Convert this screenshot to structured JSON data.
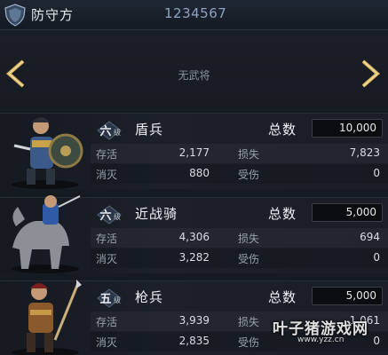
{
  "header": {
    "side_label": "防守方",
    "battle_id": "1234567"
  },
  "general": {
    "empty_text": "无武将",
    "prev_icon": "chevron-left-icon",
    "next_icon": "chevron-right-icon"
  },
  "level_suffix": "级",
  "total_label": "总数",
  "labels": {
    "survive": "存活",
    "lost": "损失",
    "killed": "消灭",
    "wounded": "受伤"
  },
  "units": [
    {
      "tier": "六",
      "name": "盾兵",
      "total": "10,000",
      "survive": "2,177",
      "lost": "7,823",
      "killed": "880",
      "wounded": "0",
      "portrait_icon": "shield-soldier-portrait"
    },
    {
      "tier": "六",
      "name": "近战骑",
      "total": "5,000",
      "survive": "4,306",
      "lost": "694",
      "killed": "3,282",
      "wounded": "0",
      "portrait_icon": "cavalry-portrait"
    },
    {
      "tier": "五",
      "name": "枪兵",
      "total": "5,000",
      "survive": "3,939",
      "lost": "1,061",
      "killed": "2,835",
      "wounded": "0",
      "portrait_icon": "spearman-portrait"
    }
  ],
  "watermark": {
    "main": "叶子猪游戏网",
    "sub": "www.yzz.cn"
  },
  "colors": {
    "background": "#161a21",
    "accent_gold": "#d9b260",
    "id_blue": "#8ea4c2"
  }
}
